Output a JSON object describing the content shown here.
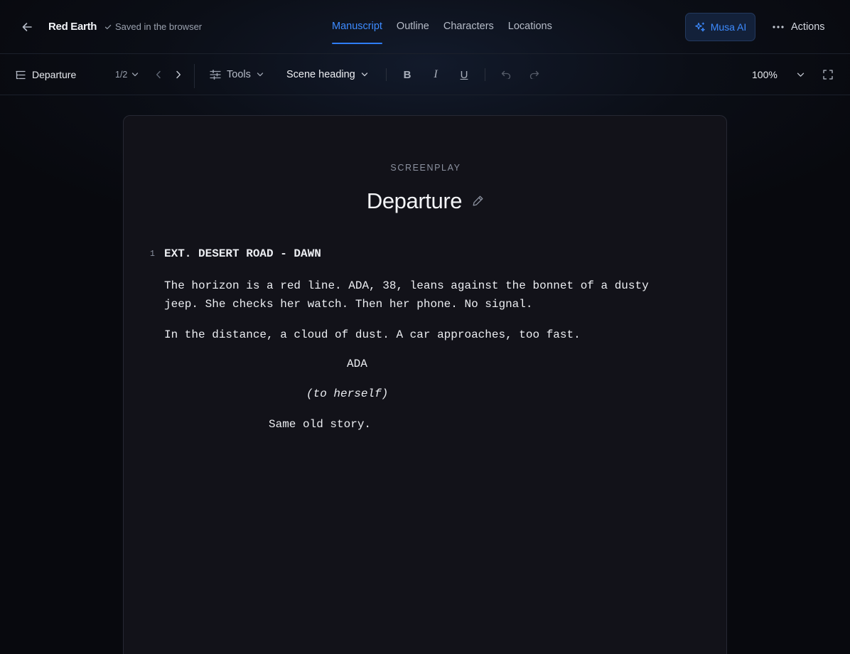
{
  "header": {
    "project_title": "Red Earth",
    "save_status": "Saved in the browser",
    "tabs": [
      {
        "label": "Manuscript",
        "active": true
      },
      {
        "label": "Outline",
        "active": false
      },
      {
        "label": "Characters",
        "active": false
      },
      {
        "label": "Locations",
        "active": false
      }
    ],
    "ai_button_label": "Musa AI",
    "actions_label": "Actions"
  },
  "toolbar": {
    "scene_label": "Departure",
    "page_indicator": "1/2",
    "tools_label": "Tools",
    "format_label": "Scene heading",
    "bold_label": "B",
    "italic_label": "I",
    "underline_label": "U",
    "zoom_label": "100%"
  },
  "document": {
    "kind_label": "SCREENPLAY",
    "title": "Departure",
    "scene_number": "1",
    "scene_heading": "EXT. DESERT ROAD - DAWN",
    "action_1_line_1": "The horizon is a red line. ADA, 38, leans against the bonnet of a dusty",
    "action_1_line_2": "jeep. She checks her watch. Then her phone. No signal.",
    "action_2": "In the distance, a cloud of dust. A car approaches, too fast.",
    "character": "ADA",
    "parenthetical": "(to herself)",
    "dialogue": "Same old story."
  },
  "colors": {
    "accent": "#3d8bff",
    "background": "#0a0c12",
    "page": "#121219"
  }
}
